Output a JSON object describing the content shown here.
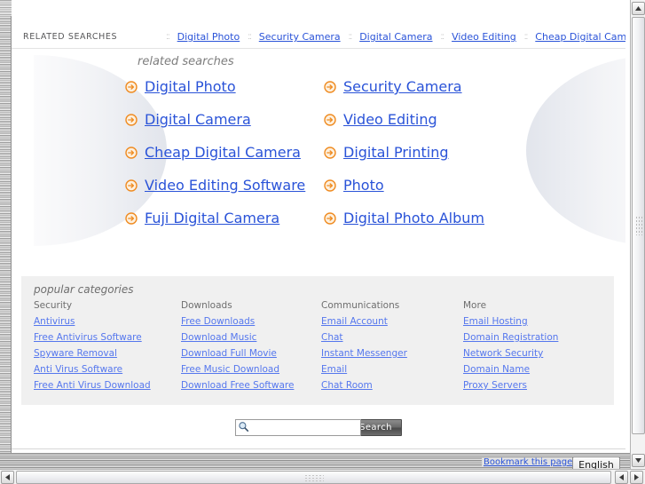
{
  "topbar": {
    "title": "RELATED SEARCHES",
    "separator": "::",
    "links": [
      "Digital Photo",
      "Security Camera",
      "Digital Camera",
      "Video Editing",
      "Cheap Digital Camera"
    ]
  },
  "related_searches": {
    "heading": "related searches",
    "icon": "orange-arrow-circle-icon",
    "items": [
      "Digital Photo",
      "Security Camera",
      "Digital Camera",
      "Video Editing",
      "Cheap Digital Camera",
      "Digital Printing",
      "Video Editing Software",
      "Photo",
      "Fuji Digital Camera",
      "Digital Photo Album"
    ]
  },
  "popular_categories": {
    "heading": "popular categories",
    "columns": [
      {
        "title": "Security",
        "links": [
          "Antivirus",
          "Free Antivirus Software",
          "Spyware Removal",
          "Anti Virus Software",
          "Free Anti Virus Download"
        ]
      },
      {
        "title": "Downloads",
        "links": [
          "Free Downloads",
          "Download Music",
          "Download Full Movie",
          "Free Music Download",
          "Download Free Software"
        ]
      },
      {
        "title": "Communications",
        "links": [
          "Email Account",
          "Chat",
          "Instant Messenger",
          "Email",
          "Chat Room"
        ]
      },
      {
        "title": "More",
        "links": [
          "Email Hosting",
          "Domain Registration",
          "Network Security",
          "Domain Name",
          "Proxy Servers"
        ]
      }
    ]
  },
  "search": {
    "value": "",
    "placeholder": "",
    "button_label": "Search",
    "icon": "magnifier-icon"
  },
  "footer": {
    "bookmark_label": "Bookmark this page |",
    "language": "English"
  },
  "colors": {
    "link_blue": "#2a53d8",
    "category_link_blue": "#5577ee",
    "arrow_orange": "#f08a1c",
    "panel_gray": "#f0f0f0",
    "muted_text": "#6e6e6e"
  }
}
